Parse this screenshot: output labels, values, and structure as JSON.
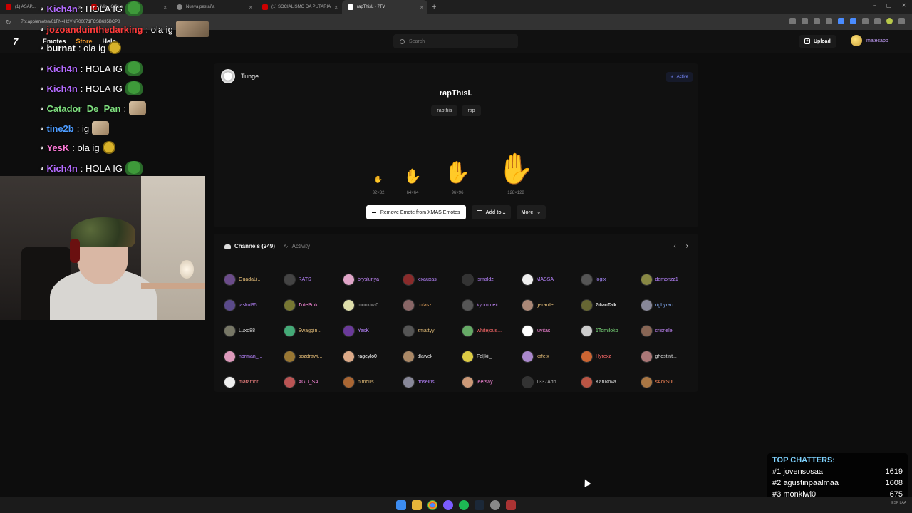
{
  "browser": {
    "tabs": [
      {
        "title": "(1) ASAP...",
        "favicon": "youtube",
        "active": false
      },
      {
        "title": "Mis...Officia",
        "favicon": "youtube",
        "active": false
      },
      {
        "title": "Nueva pestaña",
        "favicon": "globe",
        "active": false
      },
      {
        "title": "(1) SOCIALISMO DA PUTARIA",
        "favicon": "youtube",
        "active": false
      },
      {
        "title": "rapThisL - 7TV",
        "favicon": "7tv",
        "active": true
      }
    ],
    "url": "7tv.app/emotes/01FN4H2VNR00071FCSB635BCP8"
  },
  "site": {
    "logo": "7",
    "nav": [
      "Emotes",
      "Store",
      "Help"
    ],
    "search_placeholder": "Search",
    "upload_label": "Upload",
    "username": "matecapp"
  },
  "chat": [
    {
      "user": "Kich4n",
      "color": "#b46bff",
      "message": ": HOLA IG",
      "emote": "pepe"
    },
    {
      "user": "jozoanduinthedarking",
      "color": "#ff3b3b",
      "message": ": ola ig",
      "emote": "wide"
    },
    {
      "user": "burnat",
      "color": "#ffffff",
      "message": ": ola ig",
      "emote": "yellow"
    },
    {
      "user": "Kich4n",
      "color": "#b46bff",
      "message": ": HOLA IG",
      "emote": "pepe"
    },
    {
      "user": "Kich4n",
      "color": "#b46bff",
      "message": ": HOLA IG",
      "emote": "pepe"
    },
    {
      "user": "Catador_De_Pan",
      "color": "#7fe07f",
      "message": ":",
      "emote": "cat"
    },
    {
      "user": "tine2b",
      "color": "#4d9cff",
      "message": ": ig",
      "emote": "cat"
    },
    {
      "user": "YesK",
      "color": "#ff7ad9",
      "message": ": ola ig",
      "emote": "yellow"
    },
    {
      "user": "Kich4n",
      "color": "#b46bff",
      "message": ": HOLA IG",
      "emote": "pepe"
    }
  ],
  "emote": {
    "owner": "Tunge",
    "status": "Active",
    "name": "rapThisL",
    "tags": [
      "rapthis",
      "rap"
    ],
    "sizes": [
      "32×32",
      "64×64",
      "96×96",
      "128×128"
    ],
    "remove_label": "Remove Emote from XMAS Emotes",
    "add_label": "Add to...",
    "more_label": "More"
  },
  "channels": {
    "tab_channels": "Channels (249)",
    "tab_activity": "Activity",
    "list": [
      {
        "name": "GuadaLi...",
        "color": "#e8c07a",
        "pfp": "#6b4c8a"
      },
      {
        "name": "RATS",
        "color": "#b985ff",
        "pfp": "#444"
      },
      {
        "name": "bryslunya",
        "color": "#c78aff",
        "pfp": "#e0a5c8"
      },
      {
        "name": "xixauxas",
        "color": "#b985ff",
        "pfp": "#8a2b2b"
      },
      {
        "name": "ismaldz",
        "color": "#b985ff",
        "pfp": "#333"
      },
      {
        "name": "MASSA",
        "color": "#b985ff",
        "pfp": "#eee"
      },
      {
        "name": "logix",
        "color": "#a98aff",
        "pfp": "#555"
      },
      {
        "name": "demonzz1",
        "color": "#b985ff",
        "pfp": "#884"
      },
      {
        "name": "jaskol95",
        "color": "#b985ff",
        "pfp": "#5a4a8a"
      },
      {
        "name": "TutePink",
        "color": "#ff8adf",
        "pfp": "#773"
      },
      {
        "name": "monkiwi0",
        "color": "#999999",
        "pfp": "#dda"
      },
      {
        "name": "cufasz",
        "color": "#e3a15a",
        "pfp": "#866"
      },
      {
        "name": "kyommeii",
        "color": "#c78aff",
        "pfp": "#555"
      },
      {
        "name": "gerardel...",
        "color": "#e8c07a",
        "pfp": "#a87"
      },
      {
        "name": "ZilianTalk",
        "color": "#ffffff",
        "pfp": "#663"
      },
      {
        "name": "rigbyrac...",
        "color": "#8ab4ff",
        "pfp": "#889"
      },
      {
        "name": "Luxo88",
        "color": "#dddddd",
        "pfp": "#776"
      },
      {
        "name": "Swaggin...",
        "color": "#e8c07a",
        "pfp": "#4a7"
      },
      {
        "name": "YesK",
        "color": "#b985ff",
        "pfp": "#6a3a9a"
      },
      {
        "name": "zmattyy",
        "color": "#e8c07a",
        "pfp": "#555"
      },
      {
        "name": "whitejous...",
        "color": "#ff6a6a",
        "pfp": "#6a6"
      },
      {
        "name": "luyitas",
        "color": "#ff8adf",
        "pfp": "#fff"
      },
      {
        "name": "1Tomiloko",
        "color": "#7fe07f",
        "pfp": "#ccc"
      },
      {
        "name": "crisnele",
        "color": "#c78aff",
        "pfp": "#865"
      },
      {
        "name": "norman_...",
        "color": "#b985ff",
        "pfp": "#d9b"
      },
      {
        "name": "pozdrawi...",
        "color": "#e8c07a",
        "pfp": "#973"
      },
      {
        "name": "rageylo0",
        "color": "#ffffff",
        "pfp": "#da8"
      },
      {
        "name": "dlawek",
        "color": "#dddddd",
        "pfp": "#a86"
      },
      {
        "name": "Feljkii_",
        "color": "#dddddd",
        "pfp": "#dc4"
      },
      {
        "name": "kafeix",
        "color": "#e8c07a",
        "pfp": "#a8c"
      },
      {
        "name": "Hyrexz",
        "color": "#ff6a6a",
        "pfp": "#c63"
      },
      {
        "name": "ghostint...",
        "color": "#dddddd",
        "pfp": "#a77"
      },
      {
        "name": "matamor...",
        "color": "#ff8a8a",
        "pfp": "#eee"
      },
      {
        "name": "AGU_SA...",
        "color": "#ff8adf",
        "pfp": "#b55"
      },
      {
        "name": "nimbus...",
        "color": "#e8c07a",
        "pfp": "#a63"
      },
      {
        "name": "doseiris",
        "color": "#b985ff",
        "pfp": "#889"
      },
      {
        "name": "jeersay",
        "color": "#ff8adf",
        "pfp": "#c97"
      },
      {
        "name": "1337Ado...",
        "color": "#aaaaaa",
        "pfp": "#333"
      },
      {
        "name": "Karlikova...",
        "color": "#dddddd",
        "pfp": "#b54"
      },
      {
        "name": "sAckSuU",
        "color": "#ff8a5a",
        "pfp": "#a74"
      }
    ]
  },
  "top_chatters": {
    "title": "TOP CHATTERS:",
    "rows": [
      {
        "rank": "#1",
        "name": "jovensosaa",
        "count": "1619"
      },
      {
        "rank": "#2",
        "name": "agustinpaalmaa",
        "count": "1608"
      },
      {
        "rank": "#3",
        "name": "monkiwi0",
        "count": "675"
      }
    ]
  },
  "taskbar": {
    "tray_lang": "ESP LAA"
  }
}
